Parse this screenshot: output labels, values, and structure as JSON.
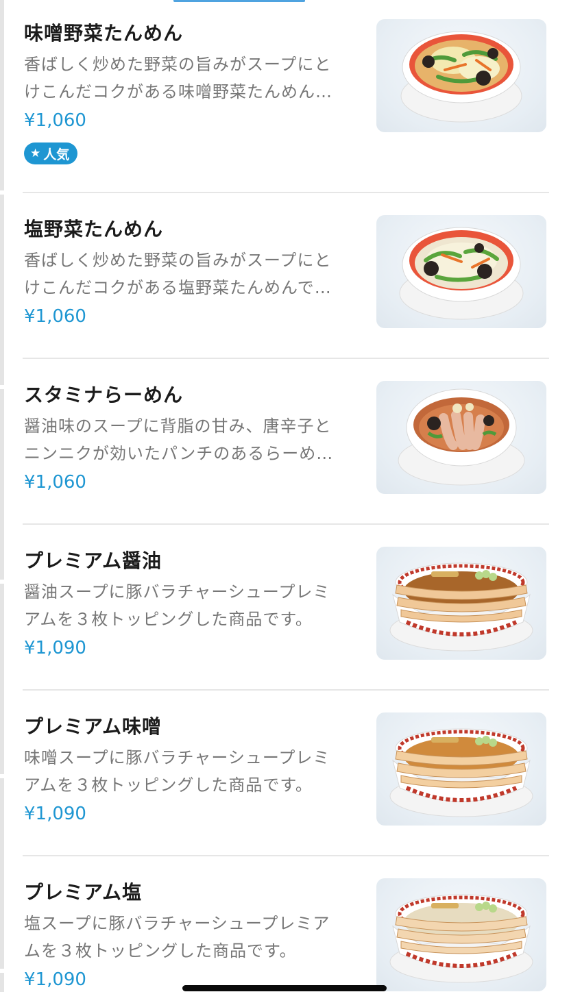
{
  "menu": {
    "items": [
      {
        "name": "味噌野菜たんめん",
        "desc_line1": "香ばしく炒めた野菜の旨みがスープにと",
        "desc_line2": "けこんだコクがある味噌野菜たんめん…",
        "price": "¥1,060",
        "badge": "人気"
      },
      {
        "name": "塩野菜たんめん",
        "desc_line1": "香ばしく炒めた野菜の旨みがスープにと",
        "desc_line2": "けこんだコクがある塩野菜たんめんで…",
        "price": "¥1,060"
      },
      {
        "name": "スタミナらーめん",
        "desc_line1": "醤油味のスープに背脂の甘み、唐辛子と",
        "desc_line2": "ニンニクが効いたパンチのあるらーめ…",
        "price": "¥1,060"
      },
      {
        "name": "プレミアム醤油",
        "desc_line1": "醤油スープに豚バラチャーシュープレミ",
        "desc_line2": "アムを３枚トッピングした商品です。",
        "price": "¥1,090"
      },
      {
        "name": "プレミアム味噌",
        "desc_line1": "味噌スープに豚バラチャーシュープレミ",
        "desc_line2": "アムを３枚トッピングした商品です。",
        "price": "¥1,090"
      },
      {
        "name": "プレミアム塩",
        "desc_line1": "塩スープに豚バラチャーシュープレミア",
        "desc_line2": "ムを３枚トッピングした商品です。",
        "price": "¥1,090"
      }
    ]
  },
  "badge_icon": "star-icon",
  "colors": {
    "accent": "#1e96d2",
    "text_primary": "#1b1b1b",
    "text_secondary": "#777777",
    "divider": "#e6e6e6"
  }
}
